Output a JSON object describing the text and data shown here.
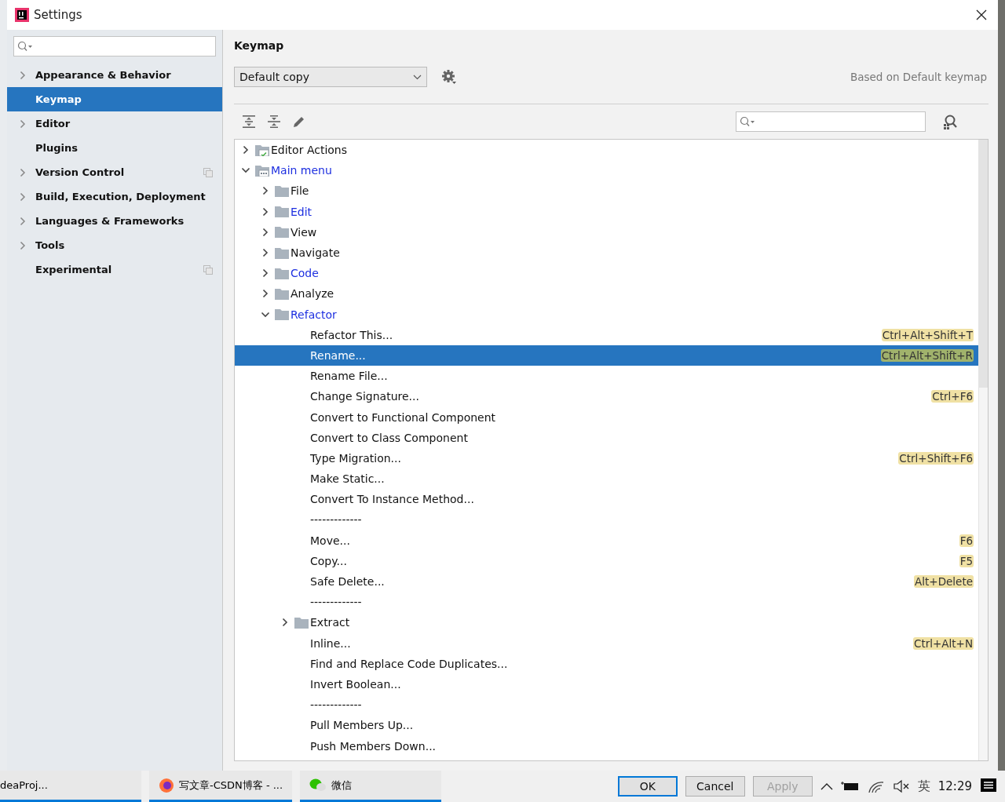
{
  "window": {
    "title": "Settings"
  },
  "sidebar": {
    "items": [
      {
        "label": "Appearance & Behavior",
        "expandable": true,
        "selected": false,
        "project_level": false
      },
      {
        "label": "Keymap",
        "expandable": false,
        "selected": true,
        "project_level": false
      },
      {
        "label": "Editor",
        "expandable": true,
        "selected": false,
        "project_level": false
      },
      {
        "label": "Plugins",
        "expandable": false,
        "selected": false,
        "project_level": false
      },
      {
        "label": "Version Control",
        "expandable": true,
        "selected": false,
        "project_level": true
      },
      {
        "label": "Build, Execution, Deployment",
        "expandable": true,
        "selected": false,
        "project_level": false
      },
      {
        "label": "Languages & Frameworks",
        "expandable": true,
        "selected": false,
        "project_level": false
      },
      {
        "label": "Tools",
        "expandable": true,
        "selected": false,
        "project_level": false
      },
      {
        "label": "Experimental",
        "expandable": false,
        "selected": false,
        "project_level": true
      }
    ]
  },
  "page": {
    "title": "Keymap",
    "keymap": "Default copy",
    "based_on": "Based on Default keymap"
  },
  "tree": [
    {
      "kind": "folder",
      "label": "Editor Actions",
      "expanded": false,
      "modified": false,
      "special": true
    },
    {
      "kind": "folder",
      "label": "Main menu",
      "expanded": true,
      "modified": true,
      "special": true,
      "children": [
        {
          "kind": "folder",
          "label": "File",
          "expanded": false,
          "modified": false
        },
        {
          "kind": "folder",
          "label": "Edit",
          "expanded": false,
          "modified": true
        },
        {
          "kind": "folder",
          "label": "View",
          "expanded": false,
          "modified": false
        },
        {
          "kind": "folder",
          "label": "Navigate",
          "expanded": false,
          "modified": false
        },
        {
          "kind": "folder",
          "label": "Code",
          "expanded": false,
          "modified": true
        },
        {
          "kind": "folder",
          "label": "Analyze",
          "expanded": false,
          "modified": false
        },
        {
          "kind": "folder",
          "label": "Refactor",
          "expanded": true,
          "modified": true,
          "children": [
            {
              "kind": "action",
              "label": "Refactor This...",
              "shortcut": "Ctrl+Alt+Shift+T",
              "selected": false
            },
            {
              "kind": "action",
              "label": "Rename...",
              "shortcut": "Ctrl+Alt+Shift+R",
              "selected": true
            },
            {
              "kind": "action",
              "label": "Rename File...",
              "selected": false
            },
            {
              "kind": "action",
              "label": "Change Signature...",
              "shortcut": "Ctrl+F6",
              "selected": false
            },
            {
              "kind": "action",
              "label": "Convert to Functional Component",
              "selected": false
            },
            {
              "kind": "action",
              "label": "Convert to Class Component",
              "selected": false
            },
            {
              "kind": "action",
              "label": "Type Migration...",
              "shortcut": "Ctrl+Shift+F6",
              "selected": false
            },
            {
              "kind": "action",
              "label": "Make Static...",
              "selected": false
            },
            {
              "kind": "action",
              "label": "Convert To Instance Method...",
              "selected": false
            },
            {
              "kind": "separator",
              "label": "-------------"
            },
            {
              "kind": "action",
              "label": "Move...",
              "shortcut": "F6",
              "selected": false
            },
            {
              "kind": "action",
              "label": "Copy...",
              "shortcut": "F5",
              "selected": false
            },
            {
              "kind": "action",
              "label": "Safe Delete...",
              "shortcut": "Alt+Delete",
              "selected": false
            },
            {
              "kind": "separator",
              "label": "-------------"
            },
            {
              "kind": "folder",
              "label": "Extract",
              "expanded": false,
              "modified": false
            },
            {
              "kind": "action",
              "label": "Inline...",
              "shortcut": "Ctrl+Alt+N",
              "selected": false
            },
            {
              "kind": "action",
              "label": "Find and Replace Code Duplicates...",
              "selected": false
            },
            {
              "kind": "action",
              "label": "Invert Boolean...",
              "selected": false
            },
            {
              "kind": "separator",
              "label": "-------------"
            },
            {
              "kind": "action",
              "label": "Pull Members Up...",
              "selected": false
            },
            {
              "kind": "action",
              "label": "Push Members Down...",
              "selected": false
            }
          ]
        }
      ]
    }
  ],
  "buttons": [
    {
      "label": "OK",
      "default": true
    },
    {
      "label": "Cancel",
      "default": false
    },
    {
      "label": "Apply",
      "default": false,
      "disabled": true
    }
  ],
  "taskbar": {
    "apps": [
      {
        "label": "deaProj...",
        "kind": "ide"
      },
      {
        "label": "写文章-CSDN博客 - ...",
        "kind": "browser"
      },
      {
        "label": "微信",
        "kind": "chat"
      }
    ],
    "ime": "英",
    "time": "12:29"
  }
}
